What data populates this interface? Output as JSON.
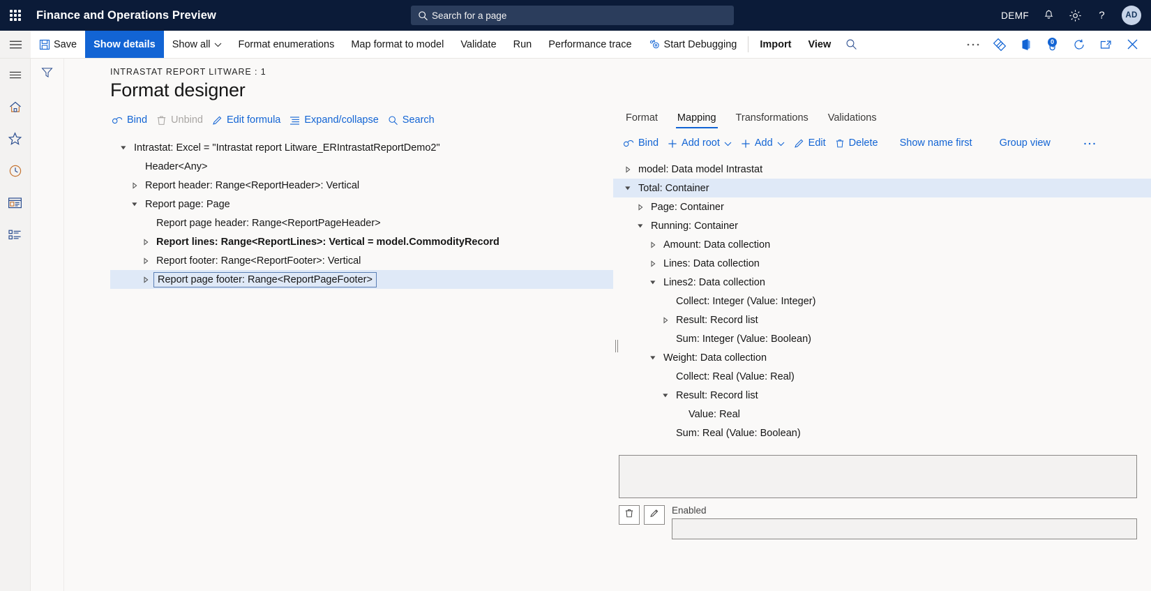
{
  "topbar": {
    "waffle_icon": "app-launcher-icon",
    "app_title": "Finance and Operations Preview",
    "search": {
      "icon": "search-icon",
      "placeholder": "Search for a page",
      "value": ""
    },
    "company": "DEMF",
    "notifications_icon": "bell-icon",
    "settings_icon": "gear-icon",
    "help_icon": "question-mark-icon",
    "avatar_initials": "AD",
    "bg_color": "#0b1b38",
    "search_bg": "#2b3d5c"
  },
  "actionpane": {
    "menu_icon": "hamburger-icon",
    "buttons": [
      {
        "label": "Save",
        "icon": "save-icon",
        "style": "normal"
      },
      {
        "label": "Show details",
        "icon": "",
        "style": "primary"
      },
      {
        "label": "Show all",
        "icon": "chevron-down-icon",
        "style": "normal"
      },
      {
        "label": "Format enumerations",
        "icon": "",
        "style": "normal"
      },
      {
        "label": "Map format to model",
        "icon": "",
        "style": "normal"
      },
      {
        "label": "Validate",
        "icon": "",
        "style": "normal"
      },
      {
        "label": "Run",
        "icon": "",
        "style": "normal"
      },
      {
        "label": "Performance trace",
        "icon": "",
        "style": "normal"
      },
      {
        "label": "Start Debugging",
        "icon": "debug-icon",
        "style": "normal"
      },
      {
        "label": "Import",
        "icon": "",
        "style": "bold"
      },
      {
        "label": "View",
        "icon": "",
        "style": "bold"
      }
    ],
    "search_icon": "search-icon",
    "right_icons": [
      "overflow-ellipsis-icon",
      "share-diamond-icon",
      "office-app-icon",
      "attachments-icon",
      "refresh-icon",
      "popout-icon",
      "close-icon"
    ],
    "attachments_count": "0",
    "accent_color": "#1264d4"
  },
  "rail": {
    "items": [
      {
        "icon": "hamburger-icon",
        "name": "expand-navigation"
      },
      {
        "icon": "home-icon",
        "name": "home"
      },
      {
        "icon": "star-icon",
        "name": "favorites"
      },
      {
        "icon": "clock-icon",
        "name": "recent"
      },
      {
        "icon": "workspace-icon",
        "name": "workspaces"
      },
      {
        "icon": "modules-icon",
        "name": "modules"
      }
    ]
  },
  "filterstrip": {
    "icon": "filter-icon"
  },
  "page": {
    "breadcrumb": "INTRASTAT REPORT LITWARE : 1",
    "title": "Format designer"
  },
  "left_pane": {
    "toolbar": [
      {
        "label": "Bind",
        "icon": "bind-link-icon",
        "disabled": false
      },
      {
        "label": "Unbind",
        "icon": "trash-icon",
        "disabled": true
      },
      {
        "label": "Edit formula",
        "icon": "pencil-icon",
        "disabled": false
      },
      {
        "label": "Expand/collapse",
        "icon": "list-icon",
        "disabled": false
      },
      {
        "label": "Search",
        "icon": "search-icon",
        "disabled": false
      }
    ],
    "tree": [
      {
        "label": "Intrastat: Excel = \"Intrastat report Litware_ERIntrastatReportDemo2\"",
        "indent": 0,
        "twisty": "expanded",
        "bold": false,
        "selected": false,
        "focused": false
      },
      {
        "label": "Header<Any>",
        "indent": 1,
        "twisty": "none",
        "bold": false,
        "selected": false,
        "focused": false
      },
      {
        "label": "Report header: Range<ReportHeader>: Vertical",
        "indent": 1,
        "twisty": "collapsed",
        "bold": false,
        "selected": false,
        "focused": false
      },
      {
        "label": "Report page: Page",
        "indent": 1,
        "twisty": "expanded",
        "bold": false,
        "selected": false,
        "focused": false
      },
      {
        "label": "Report page header: Range<ReportPageHeader>",
        "indent": 2,
        "twisty": "none",
        "bold": false,
        "selected": false,
        "focused": false
      },
      {
        "label": "Report lines: Range<ReportLines>: Vertical = model.CommodityRecord",
        "indent": 2,
        "twisty": "collapsed",
        "bold": true,
        "selected": false,
        "focused": false
      },
      {
        "label": "Report footer: Range<ReportFooter>: Vertical",
        "indent": 2,
        "twisty": "collapsed",
        "bold": false,
        "selected": false,
        "focused": false
      },
      {
        "label": "Report page footer: Range<ReportPageFooter>",
        "indent": 2,
        "twisty": "collapsed",
        "bold": false,
        "selected": true,
        "focused": true
      }
    ]
  },
  "right_pane": {
    "tabs": [
      {
        "label": "Format",
        "active": false
      },
      {
        "label": "Mapping",
        "active": true
      },
      {
        "label": "Transformations",
        "active": false
      },
      {
        "label": "Validations",
        "active": false
      }
    ],
    "toolbar": [
      {
        "label": "Bind",
        "icon": "bind-link-icon",
        "caret": false
      },
      {
        "label": "Add root",
        "icon": "plus-icon",
        "caret": true
      },
      {
        "label": "Add",
        "icon": "plus-icon",
        "caret": true
      },
      {
        "label": "Edit",
        "icon": "pencil-icon",
        "caret": false
      },
      {
        "label": "Delete",
        "icon": "trash-icon",
        "caret": false
      },
      {
        "label": "Show name first",
        "icon": "",
        "caret": false
      },
      {
        "label": "Group view",
        "icon": "",
        "caret": false
      },
      {
        "label": "",
        "icon": "overflow-ellipsis-icon",
        "caret": false
      }
    ],
    "tree": [
      {
        "label": "model: Data model Intrastat",
        "indent": 0,
        "twisty": "collapsed",
        "bold": false,
        "selected": false
      },
      {
        "label": "Total: Container",
        "indent": 0,
        "twisty": "expanded",
        "bold": false,
        "selected": true
      },
      {
        "label": "Page: Container",
        "indent": 1,
        "twisty": "collapsed",
        "bold": false,
        "selected": false
      },
      {
        "label": "Running: Container",
        "indent": 1,
        "twisty": "expanded",
        "bold": false,
        "selected": false
      },
      {
        "label": "Amount: Data collection",
        "indent": 2,
        "twisty": "collapsed",
        "bold": false,
        "selected": false
      },
      {
        "label": "Lines: Data collection",
        "indent": 2,
        "twisty": "collapsed",
        "bold": false,
        "selected": false
      },
      {
        "label": "Lines2: Data collection",
        "indent": 2,
        "twisty": "expanded",
        "bold": false,
        "selected": false
      },
      {
        "label": "Collect: Integer (Value: Integer)",
        "indent": 3,
        "twisty": "none",
        "bold": false,
        "selected": false
      },
      {
        "label": "Result: Record list",
        "indent": 3,
        "twisty": "collapsed",
        "bold": false,
        "selected": false
      },
      {
        "label": "Sum: Integer (Value: Boolean)",
        "indent": 3,
        "twisty": "none",
        "bold": false,
        "selected": false
      },
      {
        "label": "Weight: Data collection",
        "indent": 2,
        "twisty": "expanded",
        "bold": false,
        "selected": false
      },
      {
        "label": "Collect: Real (Value: Real)",
        "indent": 3,
        "twisty": "none",
        "bold": false,
        "selected": false
      },
      {
        "label": "Result: Record list",
        "indent": 3,
        "twisty": "expanded",
        "bold": false,
        "selected": false
      },
      {
        "label": "Value: Real",
        "indent": 4,
        "twisty": "none",
        "bold": false,
        "selected": false
      },
      {
        "label": "Sum: Real (Value: Boolean)",
        "indent": 3,
        "twisty": "none",
        "bold": false,
        "selected": false
      }
    ],
    "formula_value": "",
    "delete_icon": "trash-icon",
    "edit_icon": "pencil-icon",
    "enabled_label": "Enabled",
    "enabled_value": ""
  },
  "splitter": {
    "name": "pane-splitter"
  }
}
